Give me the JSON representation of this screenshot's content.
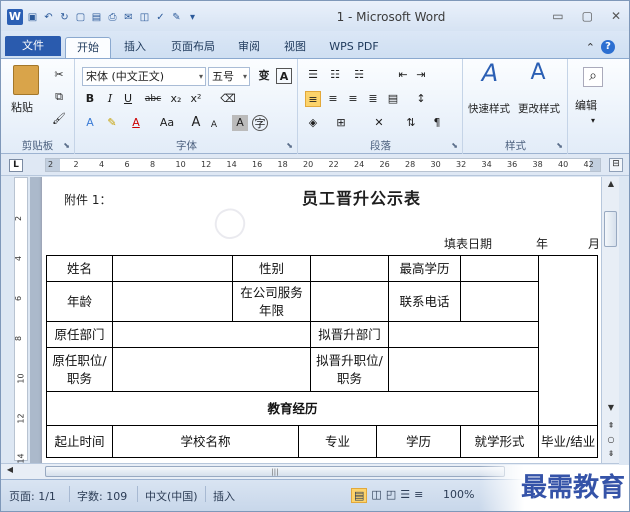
{
  "app": {
    "title": "1 - Microsoft Word",
    "logo_letter": "W"
  },
  "tabs": [
    "文件",
    "开始",
    "插入",
    "页面布局",
    "审阅",
    "视图",
    "WPS PDF"
  ],
  "ribbon": {
    "clipboard": {
      "label": "剪贴板",
      "paste": "粘贴"
    },
    "font": {
      "label": "字体",
      "font_name": "宋体 (中文正文)",
      "font_size": "五号",
      "phonetic": "变",
      "bold": "B",
      "italic": "I",
      "underline": "U",
      "strike": "abc",
      "subscript": "x₂",
      "superscript": "x²",
      "grow": "A",
      "shrink": "A",
      "case": "Aa",
      "border_a": "A"
    },
    "paragraph": {
      "label": "段落"
    },
    "styles": {
      "label": "样式",
      "quick": "快速样式",
      "change": "更改样式"
    },
    "edit": {
      "label": "编辑"
    }
  },
  "ruler": {
    "corner": "L",
    "numbers": [
      "2",
      "2",
      "4",
      "6",
      "8",
      "10",
      "12",
      "14",
      "16",
      "18",
      "20",
      "22",
      "24",
      "26",
      "28",
      "30",
      "32",
      "34",
      "36",
      "38",
      "40",
      "42"
    ],
    "vnumbers": [
      "2",
      "4",
      "6",
      "8",
      "10",
      "12",
      "14"
    ]
  },
  "document": {
    "annex": "附件 1：",
    "title": "员工晋升公示表",
    "fill_date": "填表日期",
    "year": "年",
    "month": "月",
    "rows": {
      "name": "姓名",
      "gender": "性别",
      "education": "最高学历",
      "age": "年龄",
      "tenure": "在公司服务年限",
      "phone": "联系电话",
      "orig_dept": "原任部门",
      "new_dept": "拟晋升部门",
      "orig_pos": "原任职位/职务",
      "new_pos": "拟晋升职位/职务",
      "edu_history": "教育经历",
      "start_end": "起止时间",
      "school": "学校名称",
      "major": "专业",
      "degree": "学历",
      "study_mode": "就学形式",
      "grad": "毕业/结业"
    }
  },
  "status": {
    "page": "页面: 1/1",
    "words": "字数: 109",
    "language": "中文(中国)",
    "mode": "插入",
    "zoom": "100%"
  },
  "watermark": "最需教育"
}
